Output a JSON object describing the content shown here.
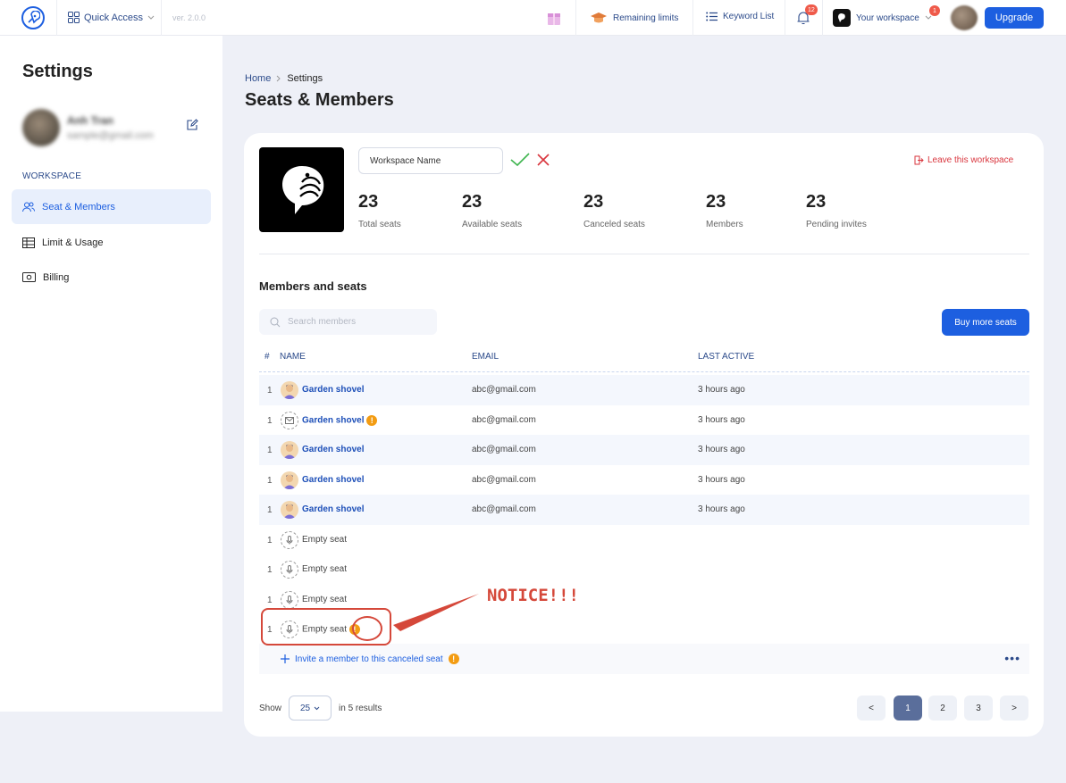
{
  "topbar": {
    "quick_access": "Quick Access",
    "version": "ver. 2.0.0",
    "remaining_limits": "Remaining limits",
    "keyword_list": "Keyword List",
    "notif_count": "12",
    "workspace": "Your workspace",
    "workspace_badge": "1",
    "upgrade": "Upgrade"
  },
  "sidebar": {
    "title": "Settings",
    "user_name": "Anh Tran",
    "user_email": "sample@gmail.com",
    "section": "WORKSPACE",
    "items": [
      {
        "label": "Seat & Members",
        "icon": "users-icon",
        "active": true
      },
      {
        "label": "Limit & Usage",
        "icon": "table-icon",
        "active": false
      },
      {
        "label": "Billing",
        "icon": "money-icon",
        "active": false
      }
    ]
  },
  "breadcrumb": {
    "home": "Home",
    "current": "Settings"
  },
  "page_title": "Seats & Members",
  "workspace_card": {
    "name_value": "Workspace Name",
    "leave": "Leave this workspace",
    "stats": [
      {
        "value": "23",
        "label": "Total seats"
      },
      {
        "value": "23",
        "label": "Available seats"
      },
      {
        "value": "23",
        "label": "Canceled seats"
      },
      {
        "value": "23",
        "label": "Members"
      },
      {
        "value": "23",
        "label": "Pending invites"
      }
    ]
  },
  "members": {
    "title": "Members and seats",
    "search_placeholder": "Search members",
    "buy_more": "Buy more seats",
    "columns": {
      "idx": "#",
      "name": "NAME",
      "email": "EMAIL",
      "last_active": "LAST ACTIVE"
    },
    "rows": [
      {
        "idx": "1",
        "name": "Garden shovel",
        "email": "abc@gmail.com",
        "last_active": "3 hours ago",
        "type": "member",
        "warn": false
      },
      {
        "idx": "1",
        "name": "Garden shovel",
        "email": "abc@gmail.com",
        "last_active": "3 hours ago",
        "type": "invited",
        "warn": true
      },
      {
        "idx": "1",
        "name": "Garden shovel",
        "email": "abc@gmail.com",
        "last_active": "3 hours ago",
        "type": "member",
        "warn": false
      },
      {
        "idx": "1",
        "name": "Garden shovel",
        "email": "abc@gmail.com",
        "last_active": "3 hours ago",
        "type": "member",
        "warn": false
      },
      {
        "idx": "1",
        "name": "Garden shovel",
        "email": "abc@gmail.com",
        "last_active": "3 hours ago",
        "type": "member",
        "warn": false
      },
      {
        "idx": "1",
        "name": "Empty seat",
        "email": "",
        "last_active": "",
        "type": "empty",
        "warn": false
      },
      {
        "idx": "1",
        "name": "Empty seat",
        "email": "",
        "last_active": "",
        "type": "empty",
        "warn": false
      },
      {
        "idx": "1",
        "name": "Empty seat",
        "email": "",
        "last_active": "",
        "type": "empty",
        "warn": false
      },
      {
        "idx": "1",
        "name": "Empty seat",
        "email": "",
        "last_active": "",
        "type": "empty",
        "warn": true
      }
    ],
    "invite": "Invite a member to this canceled seat",
    "show_label": "Show",
    "page_size": "25",
    "results": "in 5 results",
    "pages": [
      "<",
      "1",
      "2",
      "3",
      ">"
    ],
    "current_page": "1"
  },
  "annotation": {
    "text": "NOTICE!!!"
  },
  "colors": {
    "accent": "#1d5fe0",
    "danger": "#d9363e",
    "warning": "#f39c12",
    "annotation": "#d5483a"
  }
}
